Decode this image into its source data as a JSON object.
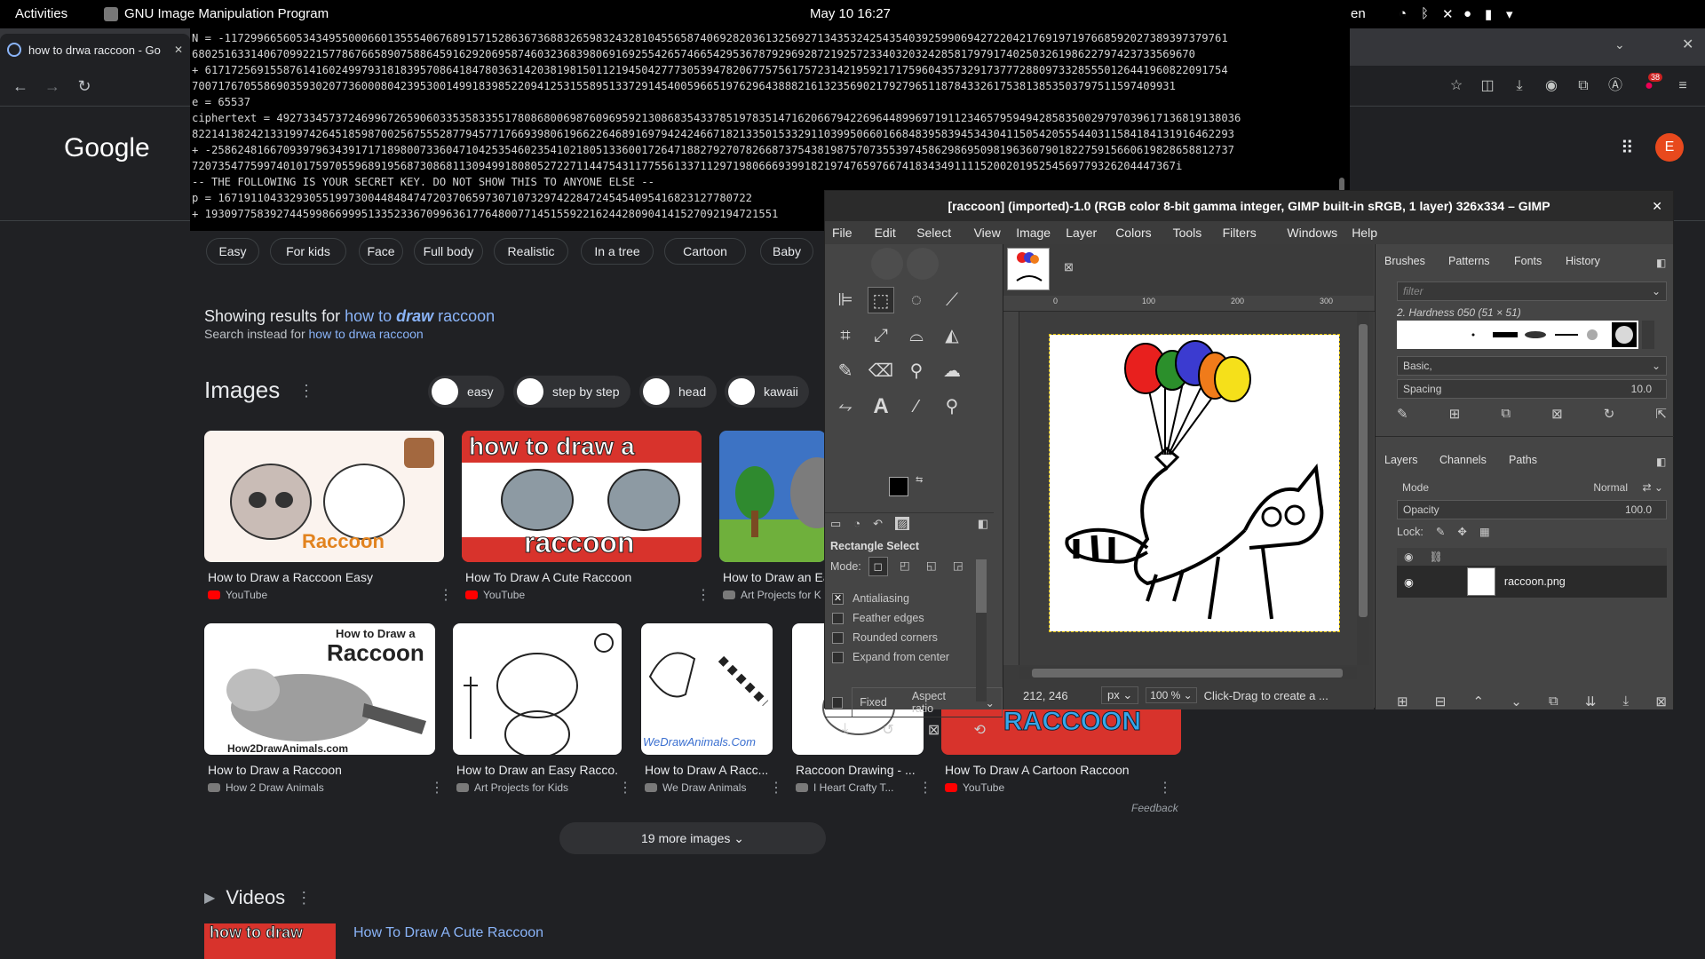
{
  "topbar": {
    "activities": "Activities",
    "app": "GNU Image Manipulation Program",
    "datetime": "May 10  16:27",
    "lang": "en"
  },
  "browser": {
    "tab_title": "how to drwa raccoon - Go",
    "ext_badge": "38",
    "avatar_letter": "E"
  },
  "terminal": {
    "lines": [
      "N = -1172996656053434955000660135554067689157152863673688326598324328104556587406928203613256927134353242543540392599069427220421769197197668592027389397379761",
      "6802516331406709922157786766589075886459162920695874603236839806916925542657466542953678792969287219257233403203242858179791740250326198622797423733569670",
      "+ 6171725691558761416024997931818395708641847803631420381981501121945042777305394782067757561757231421959217175960435732917377728809733285550126441960822091754",
      "7007176705586903593020773600080423953001499183985220941253155895133729145400596651976296438882161323569021792796511878433261753813853503797511597409931",
      "e = 65537",
      "ciphertext = 4927334573724699672659060335358335517808680069876096959213086835433785197835147162066794226964489969719112346579594942858350029797039617136819138036",
      "8221413824213319974264518598700256755528779457717669398061966226468916979424246671821335015332911039950660166848395839453430411505420555440311584184131916462293",
      "+ -2586248166709397963439171718980073360471042535460235410218051336001726471882792707826687375438198757073553974586298695098196360790182275915660619828658812737",
      "7207354775997401017597055968919568730868113094991808052722711447543117755613371129719806669399182197476597667418343491111520020195254569779326204447367i",
      "",
      "-- THE FOLLOWING IS YOUR SECRET KEY. DO NOT SHOW THIS TO ANYONE ELSE --",
      "p = 1671911043329305519973004484847472037065973071073297422847245454095416823127780722",
      "+ 1930977583927445998669995133523367099636177648007714515592216244280904141527092194721551"
    ]
  },
  "google": {
    "filters": [
      "Easy",
      "For kids",
      "Face",
      "Full body",
      "Realistic",
      "In a tree",
      "Cartoon",
      "Baby",
      "St"
    ],
    "showing_prefix": "Showing results for ",
    "showing_a": "how to ",
    "showing_b": "draw",
    "showing_c": " raccoon",
    "instead_prefix": "Search instead for ",
    "instead_link": "how to drwa raccoon",
    "images_heading": "Images",
    "suggest": [
      "easy",
      "step by step",
      "head",
      "kawaii"
    ],
    "row1": [
      {
        "title": "How to Draw a Raccoon Easy",
        "source": "YouTube"
      },
      {
        "title": "How To Draw A Cute Raccoon",
        "source": "YouTube"
      },
      {
        "title": "How to Draw an Ea",
        "source": "Art Projects for K"
      }
    ],
    "row2": [
      {
        "title": "How to Draw a Raccoon",
        "source": "How 2 Draw Animals"
      },
      {
        "title": "How to Draw an Easy Racco...",
        "source": "Art Projects for Kids"
      },
      {
        "title": "How to Draw A Racc...",
        "source": "We Draw Animals"
      },
      {
        "title": "Raccoon Drawing - ...",
        "source": "I Heart Crafty T..."
      },
      {
        "title": "How To Draw A Cartoon Raccoon",
        "source": "YouTube"
      }
    ],
    "thumb_text": {
      "r1a": "Raccoon",
      "r1b1": "how to draw a",
      "r1b2": "raccoon",
      "r2a1": "How to Draw a",
      "r2a2": "Raccoon",
      "r2a3": "How2DrawAnimals.com",
      "r2c": "WeDrawAnimals.Com",
      "r2e": "RACCOON"
    },
    "feedback": "Feedback",
    "more_images": "19 more images",
    "videos_heading": "Videos",
    "video_title": "How To Draw A Cute Raccoon",
    "video_thumb_text": "how to draw"
  },
  "gimp": {
    "title": "[raccoon] (imported)-1.0 (RGB color 8-bit gamma integer, GIMP built-in sRGB, 1 layer) 326x334 – GIMP",
    "menu": [
      "File",
      "Edit",
      "Select",
      "View",
      "Image",
      "Layer",
      "Colors",
      "Tools",
      "Filters",
      "Windows",
      "Help"
    ],
    "tool_options_title": "Rectangle Select",
    "mode_label": "Mode:",
    "options": [
      {
        "label": "Antialiasing",
        "checked": true
      },
      {
        "label": "Feather edges",
        "checked": false
      },
      {
        "label": "Rounded corners",
        "checked": false
      },
      {
        "label": "Expand from center",
        "checked": false
      }
    ],
    "fixed_label": "Fixed",
    "aspect_label": "Aspect ratio",
    "ruler": [
      "0",
      "100",
      "200",
      "300"
    ],
    "coords": "212, 246",
    "unit": "px",
    "zoom": "100 %",
    "status": "Click-Drag to create a ...",
    "dock_tabs": [
      "Brushes",
      "Patterns",
      "Fonts",
      "History"
    ],
    "filter_placeholder": "filter",
    "brush_name": "2. Hardness 050 (51 × 51)",
    "brush_set": "Basic,",
    "spacing_label": "Spacing",
    "spacing_value": "10.0",
    "layer_tabs": [
      "Layers",
      "Channels",
      "Paths"
    ],
    "mode_label2": "Mode",
    "mode_value": "Normal",
    "opacity_label": "Opacity",
    "opacity_value": "100.0",
    "lock_label": "Lock:",
    "layer_name": "raccoon.png",
    "balloon_colors": [
      "#e8201e",
      "#2b8f2b",
      "#3b3bd0",
      "#f07b1a",
      "#f5e01a"
    ]
  }
}
